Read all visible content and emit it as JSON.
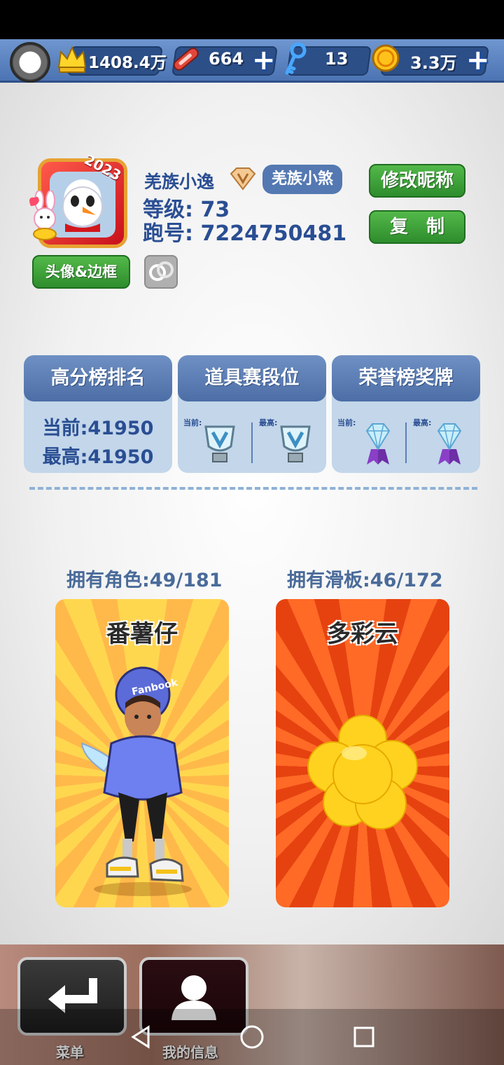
{
  "resources": {
    "crowns": "1408.4万",
    "boards": "664",
    "keys": "13",
    "coins": "3.3万",
    "plus": "+"
  },
  "profile": {
    "avatar_year": "2023",
    "name": "羌族小逸",
    "tribe_badge": "羌族小煞",
    "level": "等级: 73",
    "run_id": "跑号: 7224750481",
    "rename_button": "修改昵称",
    "copy_button": "复　制",
    "avatar_frame_button": "头像&边框"
  },
  "cards": [
    {
      "title": "高分榜排名",
      "current": "当前:41950",
      "best": "最高:41950"
    },
    {
      "title": "道具赛段位",
      "current_label": "当前:",
      "best_label": "最高:"
    },
    {
      "title": "荣誉榜奖牌",
      "current_label": "当前:",
      "best_label": "最高:"
    }
  ],
  "collection": {
    "characters_label": "拥有角色:49/181",
    "boards_label": "拥有滑板:46/172",
    "character_name": "番薯仔",
    "character_cap_text": "Fanbook",
    "board_name": "多彩云"
  },
  "bottom": {
    "menu_label": "菜单",
    "myinfo_label": "我的信息"
  },
  "colors": {
    "accent_blue": "#2a4e93",
    "green_button": "#3aa13a",
    "top_bar": "#5a80bd"
  }
}
